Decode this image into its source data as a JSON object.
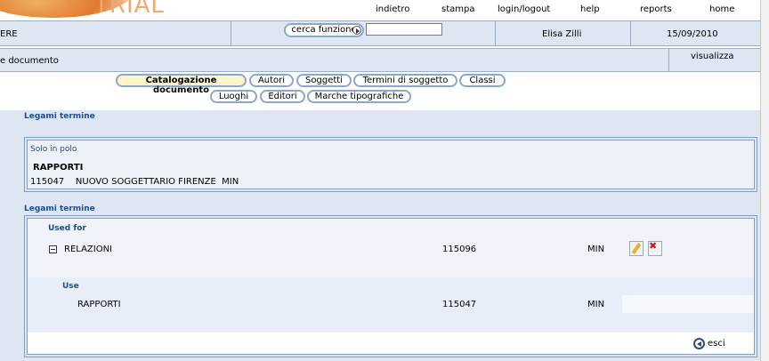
{
  "logo": {
    "text": "TRIAL"
  },
  "top_menu": {
    "indietro": "indietro",
    "stampa": "stampa",
    "login": "login/logout",
    "help": "help",
    "reports": "reports",
    "home": "home"
  },
  "header_bar": {
    "left_label": "ERE",
    "search_button": "cerca funzione",
    "search_value": "",
    "user": "Elisa Zilli",
    "date": "15/09/2010"
  },
  "context_bar": {
    "left_label": "e documento",
    "right_label": "visualizza"
  },
  "tabs_row1": [
    "Catalogazione documento",
    "Autori",
    "Soggetti",
    "Termini di soggetto",
    "Classi"
  ],
  "tabs_row2": [
    "Luoghi",
    "Editori",
    "Marche tipografiche"
  ],
  "section1": {
    "title": "Legami termine",
    "scope": "Solo in polo",
    "term": "RAPPORTI",
    "detail": "115047    NUOVO SOGGETTARIO FIRENZE  MIN"
  },
  "section2": {
    "title": "Legami termine",
    "used_for_label": "Used for",
    "used_for_row": {
      "term": "RELAZIONI",
      "id": "115096",
      "level": "MIN"
    },
    "use_label": "Use",
    "use_row": {
      "term": "RAPPORTI",
      "id": "115047",
      "level": "MIN"
    },
    "exit_label": "esci"
  }
}
